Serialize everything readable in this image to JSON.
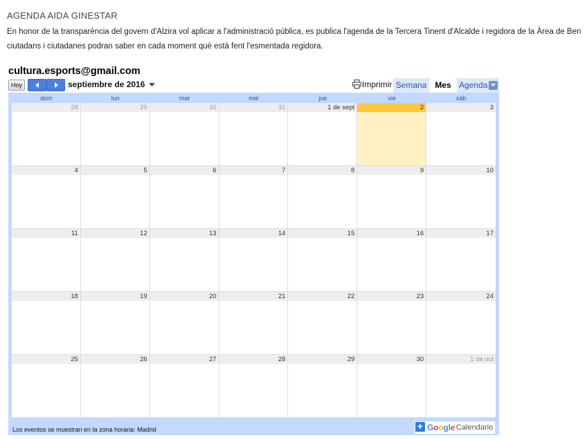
{
  "page": {
    "title": "AGENDA AIDA GINESTAR",
    "intro_line1": "En honor de la transparència del govern d'Alzira vol aplicar a l'administració pública, es publica l'agenda de la Tercera Tinent d'Alcalde i regidora de la Àrea de Ben",
    "intro_line2": "ciutadans i ciutadanes podran saber en cada moment què està fent l'esmentada regidora."
  },
  "calendar": {
    "title": "cultura.esports@gmail.com",
    "today_button": "Hoy",
    "month_label": "septiembre de 2016",
    "print_label": "Imprimir",
    "views": {
      "week": "Semana",
      "month": "Mes",
      "agenda": "Agenda"
    },
    "active_view": "Mes",
    "weekdays": [
      "dom",
      "lun",
      "mar",
      "mié",
      "jue",
      "vie",
      "sáb"
    ],
    "weeks": [
      [
        {
          "d": "28",
          "other": true
        },
        {
          "d": "29",
          "other": true
        },
        {
          "d": "30",
          "other": true
        },
        {
          "d": "31",
          "other": true
        },
        {
          "d": "1 de sept"
        },
        {
          "d": "2",
          "today": true
        },
        {
          "d": "3"
        }
      ],
      [
        {
          "d": "4"
        },
        {
          "d": "5"
        },
        {
          "d": "6"
        },
        {
          "d": "7"
        },
        {
          "d": "8"
        },
        {
          "d": "9"
        },
        {
          "d": "10"
        }
      ],
      [
        {
          "d": "11"
        },
        {
          "d": "12"
        },
        {
          "d": "13"
        },
        {
          "d": "14"
        },
        {
          "d": "15"
        },
        {
          "d": "16"
        },
        {
          "d": "17"
        }
      ],
      [
        {
          "d": "18"
        },
        {
          "d": "19"
        },
        {
          "d": "20"
        },
        {
          "d": "21"
        },
        {
          "d": "22"
        },
        {
          "d": "23"
        },
        {
          "d": "24"
        }
      ],
      [
        {
          "d": "25"
        },
        {
          "d": "26"
        },
        {
          "d": "27"
        },
        {
          "d": "28"
        },
        {
          "d": "29"
        },
        {
          "d": "30"
        },
        {
          "d": "1 de oct",
          "other": true
        }
      ]
    ],
    "timezone_note": "Los eventos se muestran en la zona horaria: Madrid",
    "brand": {
      "google": "Google",
      "product": "Calendario"
    },
    "colors": {
      "header_band": "#c3d9ff",
      "today_bg": "#fff1c4",
      "today_header": "#ffc83a",
      "accent": "#4d7ee0"
    }
  }
}
